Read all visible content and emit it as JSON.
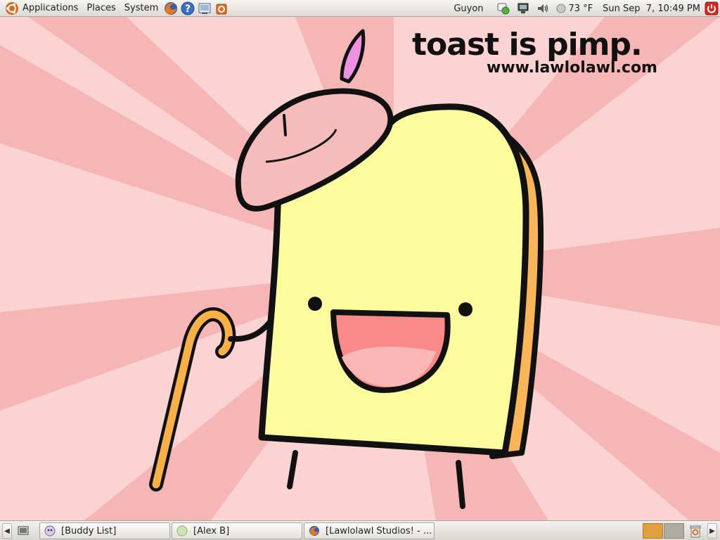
{
  "top_panel": {
    "menus": [
      {
        "label": "Applications",
        "icon": "ubuntu-logo-icon"
      },
      {
        "label": "Places"
      },
      {
        "label": "System"
      }
    ],
    "launchers": [
      "firefox-icon",
      "help-icon",
      "screenshot-icon",
      "update-manager-icon"
    ],
    "user": "Guyon",
    "weather": "73 °F",
    "clock": "Sun Sep  7, 10:49 PM"
  },
  "wallpaper": {
    "title": "toast is pimp.",
    "url": "www.lawlolawl.com"
  },
  "taskbar": {
    "tasks": [
      {
        "label": "[Buddy List]",
        "icon": "pidgin-icon"
      },
      {
        "label": "[Alex B]",
        "icon": "chat-status-icon"
      },
      {
        "label": "[Lawlolawl Studios! - ...",
        "icon": "firefox-icon"
      }
    ],
    "workspaces": [
      "workspace-1",
      "workspace-2"
    ]
  },
  "colors": {
    "wall_bg_light": "#fcd4d4",
    "wall_bg_dark": "#f5b5b5",
    "toast_body": "#fcfb9e",
    "toast_crust": "#f8b559",
    "beret": "#f6bcbc",
    "cane": "#f8b047",
    "mouth": "#fa8a8a"
  }
}
